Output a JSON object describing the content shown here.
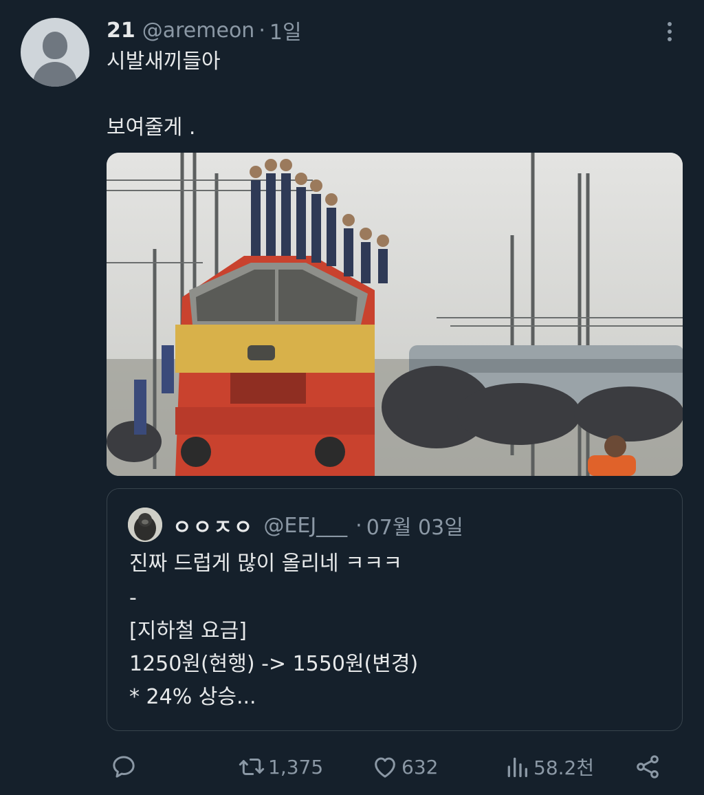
{
  "tweet": {
    "author_name": "21",
    "author_handle": "@aremeon",
    "separator": "·",
    "time": "1일",
    "text_line_1": "시발새끼들아",
    "text_line_2": "보여줄게 ."
  },
  "quote": {
    "author_name": "ㅇㅇㅈㅇ",
    "author_handle": "@EEJ___",
    "separator": "·",
    "time": "07월 03일",
    "lines": [
      "진짜 드럽게 많이 올리네 ㅋㅋㅋ",
      "-",
      "[지하철 요금]",
      "1250원(현행) -> 1550원(변경)",
      "* 24% 상승..."
    ]
  },
  "actions": {
    "reply_icon": "reply-icon",
    "retweet_count": "1,375",
    "like_count": "632",
    "views_count": "58.2천",
    "share_icon": "share-icon"
  },
  "colors": {
    "background": "#15202b",
    "text": "#e7e9ea",
    "secondary": "#8b98a5",
    "border": "#38444d"
  }
}
